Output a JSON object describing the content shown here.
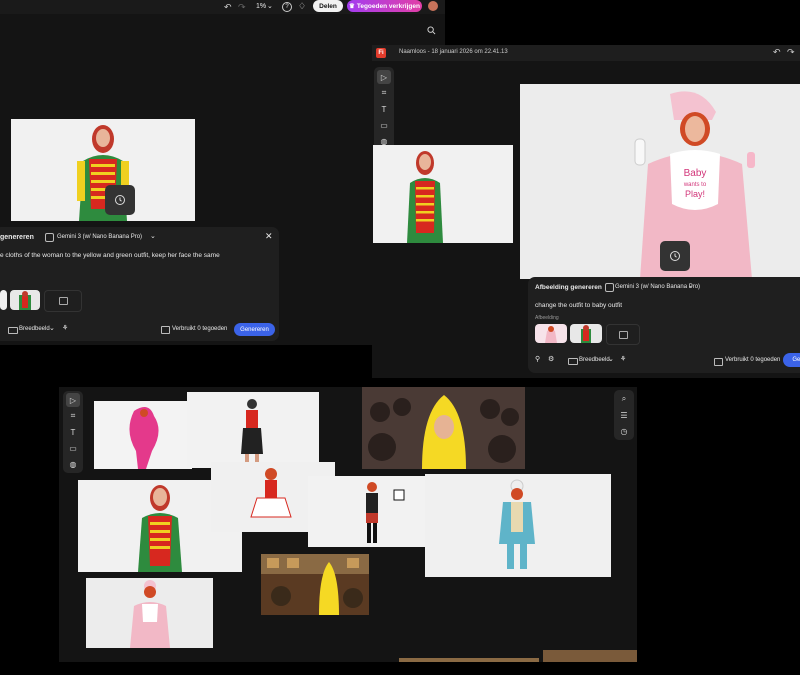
{
  "top": {
    "zoom": "1%",
    "share": "Delen",
    "credits_button": "Tegoeden verkrijgen"
  },
  "win1": {
    "panel_title": "genereren",
    "model": "Gemini 3 (w/ Nano Banana Pro)",
    "prompt": "e cloths of the woman to the yellow and green outfit, keep her face the same",
    "aspect": "Breedbeeld",
    "usage": "Verbruikt 0 tegoeden",
    "generate": "Genereren"
  },
  "win2": {
    "doc_title": "Naamloos - 18 januari 2026 om 22.41.13",
    "panel_title": "Afbeelding genereren",
    "model": "Gemini 3 (w/ Nano Banana Pro)",
    "prompt": "change the outfit to baby outfit",
    "image_label": "Afbeelding",
    "aspect": "Breedbeeld",
    "usage": "Verbruikt 0 tegoeden",
    "generate": "Gen",
    "bib_text_1": "Baby",
    "bib_text_2": "wants to",
    "bib_text_3": "Play!"
  },
  "colors": {
    "background": "#000000",
    "canvas": "#141414",
    "panel": "#1f1f1f",
    "accent": "#3b63e8",
    "brand": "#e23c2c"
  }
}
